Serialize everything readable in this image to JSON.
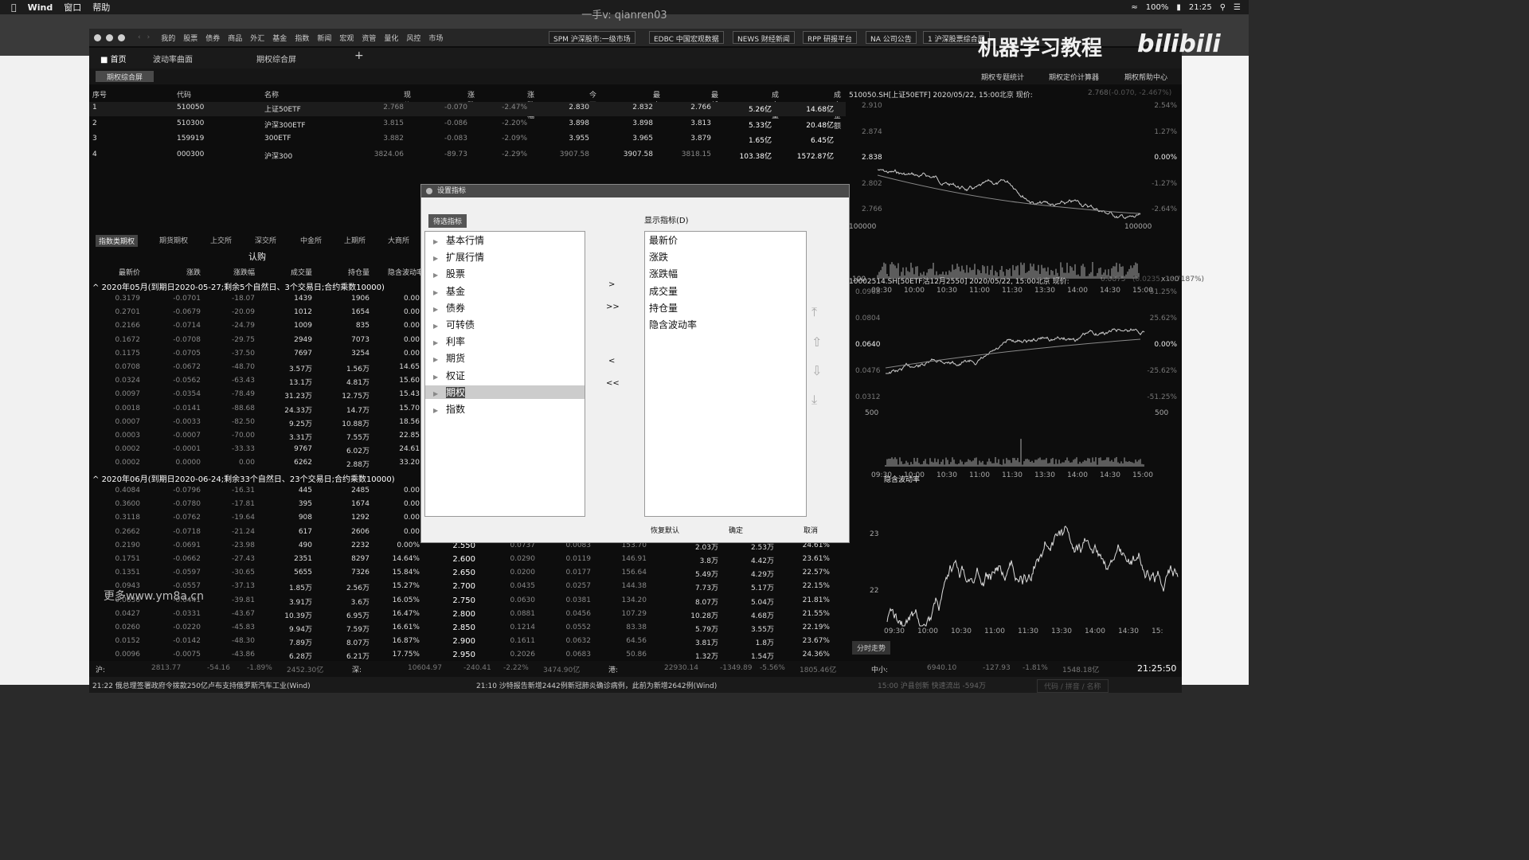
{
  "menubar": {
    "app": "Wind",
    "items": [
      "窗口",
      "帮助"
    ],
    "battery": "100%",
    "time": "21:25"
  },
  "window_title": "一手v: qianren03",
  "app_nav": [
    "我的",
    "股票",
    "债券",
    "商品",
    "外汇",
    "基金",
    "指数",
    "新闻",
    "宏观",
    "资管",
    "量化",
    "风控",
    "市场"
  ],
  "toolbar_buttons": [
    "SPM 沪深股市:一级市场",
    "EDBC 中国宏观数据",
    "NEWS 财经新闻",
    "RPP 研报平台",
    "NA 公司公告",
    "1 沪深股票综合屏"
  ],
  "watermark": "机器学习教程",
  "logo": "bilibili",
  "tabs": [
    "首页",
    "波动率曲面",
    "期权综合屏"
  ],
  "tab_add": "+",
  "sub": {
    "active": "期权综合屏",
    "right": [
      "期权专题统计",
      "期权定价计算器",
      "期权帮助中心"
    ]
  },
  "top_table": {
    "headers": [
      "序号",
      "代码",
      "名称",
      "现价",
      "涨跌",
      "涨跌幅",
      "今开",
      "最高",
      "最低",
      "成交量",
      "成交金额"
    ],
    "rows": [
      [
        "1",
        "510050",
        "上证50ETF",
        "2.768",
        "-0.070",
        "-2.47%",
        "2.830",
        "2.832",
        "2.766",
        "5.26亿",
        "14.68亿"
      ],
      [
        "2",
        "510300",
        "沪深300ETF",
        "3.815",
        "-0.086",
        "-2.20%",
        "3.898",
        "3.898",
        "3.813",
        "5.33亿",
        "20.48亿"
      ],
      [
        "3",
        "159919",
        "300ETF",
        "3.882",
        "-0.083",
        "-2.09%",
        "3.955",
        "3.965",
        "3.879",
        "1.65亿",
        "6.45亿"
      ],
      [
        "4",
        "000300",
        "沪深300",
        "3824.06",
        "-89.73",
        "-2.29%",
        "3907.58",
        "3907.58",
        "3818.15",
        "103.38亿",
        "1572.87亿"
      ]
    ]
  },
  "exch_tabs": [
    "指数类期权",
    "期货期权",
    "上交所",
    "深交所",
    "中金所",
    "上期所",
    "大商所"
  ],
  "call_label": "认购",
  "opt_headers": [
    "最新价",
    "涨跌",
    "涨跌幅",
    "成交量",
    "持仓量",
    "隐含波动率"
  ],
  "group1": "2020年05月(到期日2020-05-27;剩余5个自然日、3个交易日;合约乘数10000)",
  "rows1": [
    [
      "0.3179",
      "-0.0701",
      "-18.07",
      "1439",
      "1906",
      "0.00"
    ],
    [
      "0.2701",
      "-0.0679",
      "-20.09",
      "1012",
      "1654",
      "0.00"
    ],
    [
      "0.2166",
      "-0.0714",
      "-24.79",
      "1009",
      "835",
      "0.00"
    ],
    [
      "0.1672",
      "-0.0708",
      "-29.75",
      "2949",
      "7073",
      "0.00"
    ],
    [
      "0.1175",
      "-0.0705",
      "-37.50",
      "7697",
      "3254",
      "0.00"
    ],
    [
      "0.0708",
      "-0.0672",
      "-48.70",
      "3.57万",
      "1.56万",
      "14.65"
    ],
    [
      "0.0324",
      "-0.0562",
      "-63.43",
      "13.1万",
      "4.81万",
      "15.60"
    ],
    [
      "0.0097",
      "-0.0354",
      "-78.49",
      "31.23万",
      "12.75万",
      "15.43"
    ],
    [
      "0.0018",
      "-0.0141",
      "-88.68",
      "24.33万",
      "14.7万",
      "15.70"
    ],
    [
      "0.0007",
      "-0.0033",
      "-82.50",
      "9.25万",
      "10.88万",
      "18.56"
    ],
    [
      "0.0003",
      "-0.0007",
      "-70.00",
      "3.31万",
      "7.55万",
      "22.85"
    ],
    [
      "0.0002",
      "-0.0001",
      "-33.33",
      "9767",
      "6.02万",
      "24.61"
    ],
    [
      "0.0002",
      "0.0000",
      "0.00",
      "6262",
      "2.88万",
      "33.20"
    ]
  ],
  "group2": "2020年06月(到期日2020-06-24;剩余33个自然日、23个交易日;合约乘数10000)",
  "rows2": [
    [
      "0.4084",
      "-0.0796",
      "-16.31",
      "445",
      "2485",
      "0.00",
      "",
      "",
      "",
      "",
      "",
      "",
      ""
    ],
    [
      "0.3600",
      "-0.0780",
      "-17.81",
      "395",
      "1674",
      "0.00",
      "",
      "",
      "",
      "",
      "",
      "",
      ""
    ],
    [
      "0.3118",
      "-0.0762",
      "-19.64",
      "908",
      "1292",
      "0.00",
      "",
      "",
      "",
      "",
      "",
      "",
      ""
    ],
    [
      "0.2662",
      "-0.0718",
      "-21.24",
      "617",
      "2606",
      "0.00",
      "",
      "",
      "",
      "",
      "",
      "",
      ""
    ],
    [
      "0.2190",
      "-0.0691",
      "-23.98",
      "490",
      "2232",
      "0.00%",
      "2.550",
      "0.0737",
      "0.0083",
      "153.70",
      "2.03万",
      "2.53万",
      "24.61%"
    ],
    [
      "0.1751",
      "-0.0662",
      "-27.43",
      "2351",
      "8297",
      "14.64%",
      "2.600",
      "0.0290",
      "0.0119",
      "146.91",
      "3.8万",
      "4.42万",
      "23.61%"
    ],
    [
      "0.1351",
      "-0.0597",
      "-30.65",
      "5655",
      "7326",
      "15.84%",
      "2.650",
      "0.0200",
      "0.0177",
      "156.64",
      "5.49万",
      "4.29万",
      "22.57%"
    ],
    [
      "0.0943",
      "-0.0557",
      "-37.13",
      "1.85万",
      "2.56万",
      "15.27%",
      "2.700",
      "0.0435",
      "0.0257",
      "144.38",
      "7.73万",
      "5.17万",
      "22.15%"
    ],
    [
      "0.0636",
      "-0.0441",
      "-39.81",
      "3.91万",
      "3.6万",
      "16.05%",
      "2.750",
      "0.0630",
      "0.0381",
      "134.20",
      "8.07万",
      "5.04万",
      "21.81%"
    ],
    [
      "0.0427",
      "-0.0331",
      "-43.67",
      "10.39万",
      "6.95万",
      "16.47%",
      "2.800",
      "0.0881",
      "0.0456",
      "107.29",
      "10.28万",
      "4.68万",
      "21.55%"
    ],
    [
      "0.0260",
      "-0.0220",
      "-45.83",
      "9.94万",
      "7.59万",
      "16.61%",
      "2.850",
      "0.1214",
      "0.0552",
      "83.38",
      "5.79万",
      "3.55万",
      "22.19%"
    ],
    [
      "0.0152",
      "-0.0142",
      "-48.30",
      "7.89万",
      "8.07万",
      "16.87%",
      "2.900",
      "0.1611",
      "0.0632",
      "64.56",
      "3.81万",
      "1.8万",
      "23.67%"
    ],
    [
      "0.0096",
      "-0.0075",
      "-43.86",
      "6.28万",
      "6.21万",
      "17.75%",
      "2.950",
      "0.2026",
      "0.0683",
      "50.86",
      "1.32万",
      "1.54万",
      "24.36%"
    ]
  ],
  "site_watermark": "更多www.ym8a.cn",
  "dialog": {
    "title": "设置指标",
    "left_label": "待选指标",
    "right_label": "显示指标(D)",
    "tree": [
      "基本行情",
      "扩展行情",
      "股票",
      "基金",
      "债券",
      "可转债",
      "利率",
      "期货",
      "权证",
      "期权",
      "指数"
    ],
    "selected": "期权",
    "shown": [
      "最新价",
      "涨跌",
      "涨跌幅",
      "成交量",
      "持仓量",
      "隐含波动率"
    ],
    "move": [
      ">",
      ">>",
      "<",
      "<<"
    ],
    "buttons": [
      "恢复默认",
      "确定",
      "取消"
    ]
  },
  "chart1": {
    "title": "510050.SH[上证50ETF] 2020/05/22, 15:00北京 现价:",
    "price": "2.768",
    "chg": "(-0.070, -2.467%)",
    "avg_label": "均价:",
    "avg": "2.7888",
    "yticks": [
      "2.910",
      "2.874",
      "2.838",
      "2.802",
      "2.766"
    ],
    "rticks": [
      "2.54%",
      "1.27%",
      "0.00%",
      "-1.27%",
      "-2.64%"
    ],
    "vol": [
      "100000",
      "100000",
      "100",
      "x100"
    ],
    "x": [
      "09:30",
      "10:00",
      "10:30",
      "11:00",
      "11:30",
      "13:30",
      "14:00",
      "14:30",
      "15:00"
    ]
  },
  "chart2": {
    "title": "10002514.SH[50ETF沽12月2550] 2020/05/22, 15:00北京 现价:",
    "price": "0.0875",
    "chg": "(0.0235, 36.7187%)",
    "yticks": [
      "0.0968",
      "0.0804",
      "0.0640",
      "0.0476",
      "0.0312"
    ],
    "rticks": [
      "51.25%",
      "25.62%",
      "0.00%",
      "-25.62%",
      "-51.25%"
    ],
    "vol": [
      "500",
      "500"
    ],
    "x": [
      "09:30",
      "10:00",
      "10:30",
      "11:00",
      "11:30",
      "13:30",
      "14:00",
      "14:30",
      "15:00"
    ]
  },
  "chart3": {
    "title": "隐含波动率",
    "yticks": [
      "23",
      "22"
    ],
    "x": [
      "09:30",
      "10:00",
      "10:30",
      "11:00",
      "11:30",
      "13:30",
      "14:00",
      "14:30",
      "15:"
    ]
  },
  "chart_btn": "分时走势",
  "indices": [
    {
      "name": "沪:",
      "v": "2813.77",
      "c": "-54.16",
      "p": "-1.89%",
      "a": "2452.30亿"
    },
    {
      "name": "深:",
      "v": "10604.97",
      "c": "-240.41",
      "p": "-2.22%",
      "a": "3474.90亿"
    },
    {
      "name": "港:",
      "v": "22930.14",
      "c": "-1349.89",
      "p": "-5.56%",
      "a": "1805.46亿"
    },
    {
      "name": "中小:",
      "v": "6940.10",
      "c": "-127.93",
      "p": "-1.81%",
      "a": "1548.18亿"
    }
  ],
  "clock": "21:25:50",
  "news": [
    "21:22 俄总理签署政府令拨款250亿卢布支持俄罗斯汽车工业(Wind)",
    "21:10 沙特报告新增2442例新冠肺炎确诊病例，此前为新增2642例(Wind)",
    "15:00 沪县创新  快速流出  -594万",
    "代码 / 拼音 / 名称"
  ]
}
